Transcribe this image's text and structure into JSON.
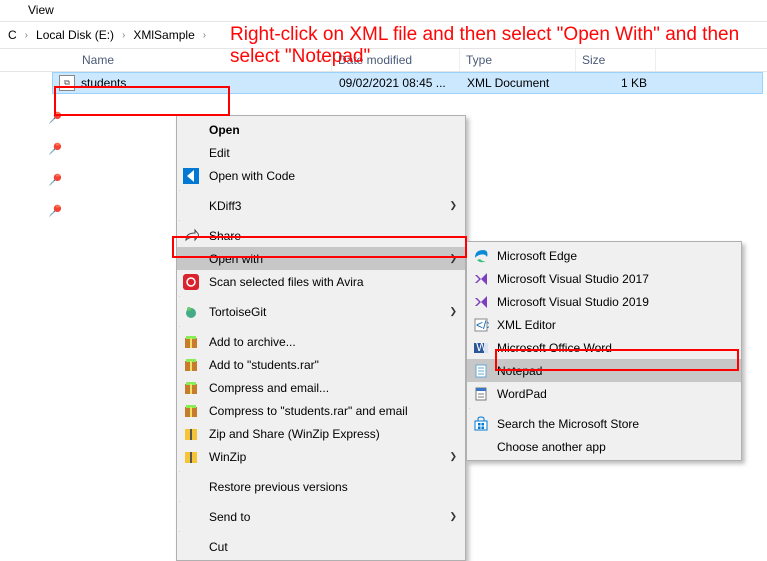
{
  "tabs": {
    "view": "View"
  },
  "breadcrumb": {
    "root": "C",
    "drive": "Local Disk (E:)",
    "folder": "XMlSample"
  },
  "annotation": "Right-click on XML file and then select \"Open With\" and then select \"Notepad\"",
  "headers": {
    "name": "Name",
    "date": "Date modified",
    "type": "Type",
    "size": "Size"
  },
  "file": {
    "name": "students",
    "date": "09/02/2021 08:45 ...",
    "type": "XML Document",
    "size": "1 KB"
  },
  "ctx": {
    "open": "Open",
    "edit": "Edit",
    "openCode": "Open with Code",
    "kdiff3": "KDiff3",
    "share": "Share",
    "openWith": "Open with",
    "scanAvira": "Scan selected files with Avira",
    "tortoise": "TortoiseGit",
    "addArchive": "Add to archive...",
    "addRar": "Add to \"students.rar\"",
    "compEmail": "Compress and email...",
    "compRarEmail": "Compress to \"students.rar\" and email",
    "zipShare": "Zip and Share (WinZip Express)",
    "winzip": "WinZip",
    "restore": "Restore previous versions",
    "sendTo": "Send to",
    "cut": "Cut"
  },
  "sub": {
    "edge": "Microsoft Edge",
    "vs2017": "Microsoft Visual Studio 2017",
    "vs2019": "Microsoft Visual Studio 2019",
    "xmlEditor": "XML Editor",
    "word": "Microsoft Office Word",
    "notepad": "Notepad",
    "wordpad": "WordPad",
    "store": "Search the Microsoft Store",
    "choose": "Choose another app"
  }
}
